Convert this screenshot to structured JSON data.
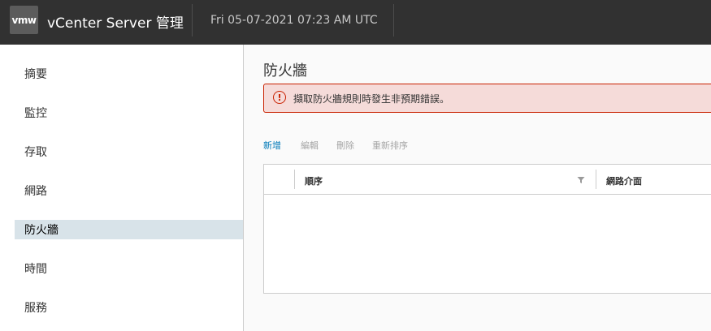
{
  "header": {
    "logo_text": "vmw",
    "app_title": "vCenter Server 管理",
    "datetime": "Fri 05-07-2021 07:23 AM UTC"
  },
  "sidebar": {
    "items": [
      {
        "label": "摘要",
        "active": false
      },
      {
        "label": "監控",
        "active": false
      },
      {
        "label": "存取",
        "active": false
      },
      {
        "label": "網路",
        "active": false
      },
      {
        "label": "防火牆",
        "active": true
      },
      {
        "label": "時間",
        "active": false
      },
      {
        "label": "服務",
        "active": false
      }
    ]
  },
  "main": {
    "title": "防火牆",
    "alert": {
      "icon": "error-circle-icon",
      "message": "擷取防火牆規則時發生非預期錯誤。",
      "color": "#c92100"
    },
    "toolbar": {
      "add": "新增",
      "edit": "編輯",
      "delete": "刪除",
      "reorder": "重新排序"
    },
    "grid": {
      "columns": [
        "順序",
        "網路介面"
      ],
      "filter_icon": "filter-icon",
      "rows": []
    }
  },
  "colors": {
    "header_bg": "#313131",
    "active_nav_bg": "#d8e3e9",
    "link_blue": "#0079b8",
    "error_red": "#c92100",
    "error_bg": "#f5dbd9"
  }
}
